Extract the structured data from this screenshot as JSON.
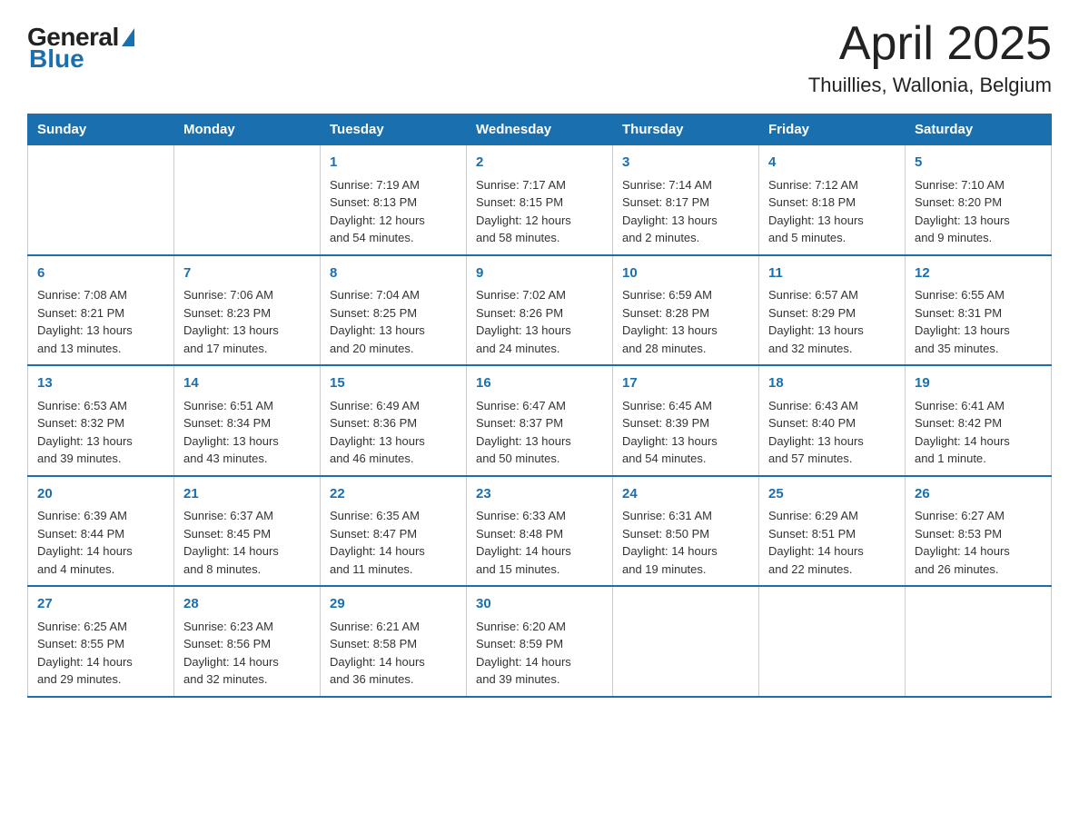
{
  "header": {
    "logo_general": "General",
    "logo_blue": "Blue",
    "month_title": "April 2025",
    "location": "Thuillies, Wallonia, Belgium"
  },
  "weekdays": [
    "Sunday",
    "Monday",
    "Tuesday",
    "Wednesday",
    "Thursday",
    "Friday",
    "Saturday"
  ],
  "weeks": [
    [
      {
        "day": "",
        "info": ""
      },
      {
        "day": "",
        "info": ""
      },
      {
        "day": "1",
        "info": "Sunrise: 7:19 AM\nSunset: 8:13 PM\nDaylight: 12 hours\nand 54 minutes."
      },
      {
        "day": "2",
        "info": "Sunrise: 7:17 AM\nSunset: 8:15 PM\nDaylight: 12 hours\nand 58 minutes."
      },
      {
        "day": "3",
        "info": "Sunrise: 7:14 AM\nSunset: 8:17 PM\nDaylight: 13 hours\nand 2 minutes."
      },
      {
        "day": "4",
        "info": "Sunrise: 7:12 AM\nSunset: 8:18 PM\nDaylight: 13 hours\nand 5 minutes."
      },
      {
        "day": "5",
        "info": "Sunrise: 7:10 AM\nSunset: 8:20 PM\nDaylight: 13 hours\nand 9 minutes."
      }
    ],
    [
      {
        "day": "6",
        "info": "Sunrise: 7:08 AM\nSunset: 8:21 PM\nDaylight: 13 hours\nand 13 minutes."
      },
      {
        "day": "7",
        "info": "Sunrise: 7:06 AM\nSunset: 8:23 PM\nDaylight: 13 hours\nand 17 minutes."
      },
      {
        "day": "8",
        "info": "Sunrise: 7:04 AM\nSunset: 8:25 PM\nDaylight: 13 hours\nand 20 minutes."
      },
      {
        "day": "9",
        "info": "Sunrise: 7:02 AM\nSunset: 8:26 PM\nDaylight: 13 hours\nand 24 minutes."
      },
      {
        "day": "10",
        "info": "Sunrise: 6:59 AM\nSunset: 8:28 PM\nDaylight: 13 hours\nand 28 minutes."
      },
      {
        "day": "11",
        "info": "Sunrise: 6:57 AM\nSunset: 8:29 PM\nDaylight: 13 hours\nand 32 minutes."
      },
      {
        "day": "12",
        "info": "Sunrise: 6:55 AM\nSunset: 8:31 PM\nDaylight: 13 hours\nand 35 minutes."
      }
    ],
    [
      {
        "day": "13",
        "info": "Sunrise: 6:53 AM\nSunset: 8:32 PM\nDaylight: 13 hours\nand 39 minutes."
      },
      {
        "day": "14",
        "info": "Sunrise: 6:51 AM\nSunset: 8:34 PM\nDaylight: 13 hours\nand 43 minutes."
      },
      {
        "day": "15",
        "info": "Sunrise: 6:49 AM\nSunset: 8:36 PM\nDaylight: 13 hours\nand 46 minutes."
      },
      {
        "day": "16",
        "info": "Sunrise: 6:47 AM\nSunset: 8:37 PM\nDaylight: 13 hours\nand 50 minutes."
      },
      {
        "day": "17",
        "info": "Sunrise: 6:45 AM\nSunset: 8:39 PM\nDaylight: 13 hours\nand 54 minutes."
      },
      {
        "day": "18",
        "info": "Sunrise: 6:43 AM\nSunset: 8:40 PM\nDaylight: 13 hours\nand 57 minutes."
      },
      {
        "day": "19",
        "info": "Sunrise: 6:41 AM\nSunset: 8:42 PM\nDaylight: 14 hours\nand 1 minute."
      }
    ],
    [
      {
        "day": "20",
        "info": "Sunrise: 6:39 AM\nSunset: 8:44 PM\nDaylight: 14 hours\nand 4 minutes."
      },
      {
        "day": "21",
        "info": "Sunrise: 6:37 AM\nSunset: 8:45 PM\nDaylight: 14 hours\nand 8 minutes."
      },
      {
        "day": "22",
        "info": "Sunrise: 6:35 AM\nSunset: 8:47 PM\nDaylight: 14 hours\nand 11 minutes."
      },
      {
        "day": "23",
        "info": "Sunrise: 6:33 AM\nSunset: 8:48 PM\nDaylight: 14 hours\nand 15 minutes."
      },
      {
        "day": "24",
        "info": "Sunrise: 6:31 AM\nSunset: 8:50 PM\nDaylight: 14 hours\nand 19 minutes."
      },
      {
        "day": "25",
        "info": "Sunrise: 6:29 AM\nSunset: 8:51 PM\nDaylight: 14 hours\nand 22 minutes."
      },
      {
        "day": "26",
        "info": "Sunrise: 6:27 AM\nSunset: 8:53 PM\nDaylight: 14 hours\nand 26 minutes."
      }
    ],
    [
      {
        "day": "27",
        "info": "Sunrise: 6:25 AM\nSunset: 8:55 PM\nDaylight: 14 hours\nand 29 minutes."
      },
      {
        "day": "28",
        "info": "Sunrise: 6:23 AM\nSunset: 8:56 PM\nDaylight: 14 hours\nand 32 minutes."
      },
      {
        "day": "29",
        "info": "Sunrise: 6:21 AM\nSunset: 8:58 PM\nDaylight: 14 hours\nand 36 minutes."
      },
      {
        "day": "30",
        "info": "Sunrise: 6:20 AM\nSunset: 8:59 PM\nDaylight: 14 hours\nand 39 minutes."
      },
      {
        "day": "",
        "info": ""
      },
      {
        "day": "",
        "info": ""
      },
      {
        "day": "",
        "info": ""
      }
    ]
  ]
}
